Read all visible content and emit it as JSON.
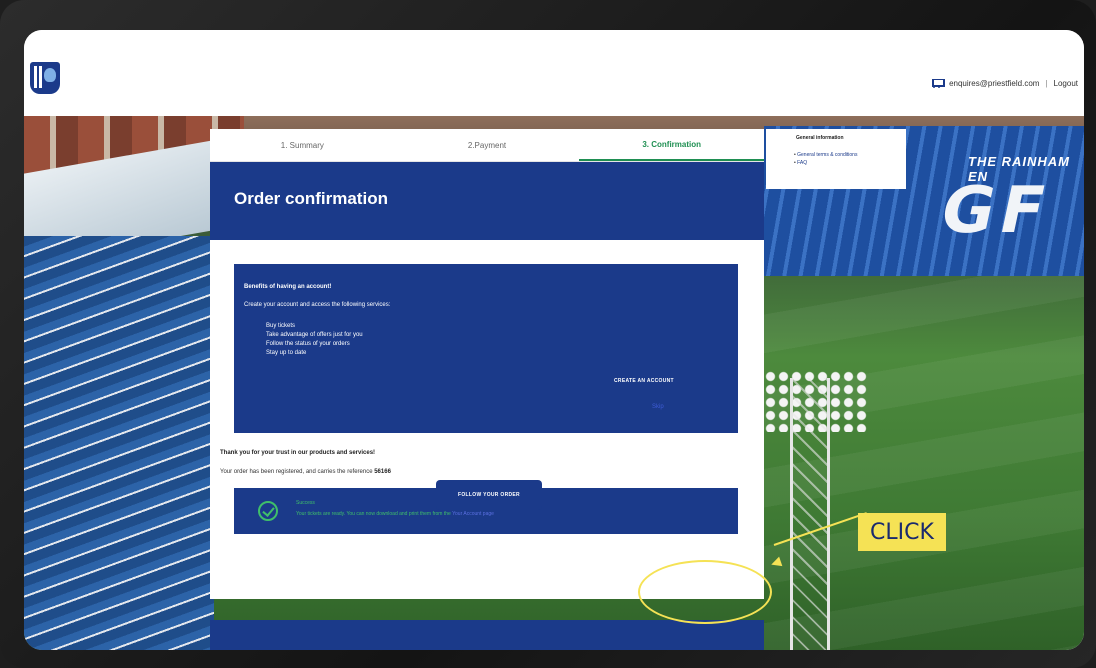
{
  "header": {
    "email": "enquires@priestfield.com",
    "separator": "|",
    "logout_label": "Logout"
  },
  "tabs": [
    {
      "label": "1. Summary"
    },
    {
      "label": "2.Payment"
    },
    {
      "label": "3. Confirmation"
    }
  ],
  "hero": {
    "title": "Order confirmation"
  },
  "benefits": {
    "title": "Benefits of having an account!",
    "intro": "Create your account and access the following services:",
    "items": [
      "Buy tickets",
      "Take advantage of offers just for you",
      "Follow the status of your orders",
      "Stay up to date"
    ],
    "create_account_label": "CREATE AN ACCOUNT",
    "link_label": "Skip"
  },
  "thanks": "Thank you for your trust in our products and services!",
  "reference": {
    "text": "Your order has been registered, and carries the reference",
    "number": "56166"
  },
  "success": {
    "title": "Success",
    "text": "Your tickets are ready. You can now download and print them from the",
    "link": "Your Account page"
  },
  "follow_button_label": "FOLLOW YOUR ORDER",
  "info": {
    "title": "General information",
    "items": [
      "General terms & conditions",
      "FAQ"
    ]
  },
  "stadium": {
    "banner": "THE RAINHAM EN",
    "letters": "GF"
  },
  "annotation": {
    "label": "CLICK",
    "color": "#f5e255"
  },
  "colors": {
    "primary": "#1b3a8a",
    "active_tab": "#1f8f52",
    "success": "#3fbf6a"
  }
}
